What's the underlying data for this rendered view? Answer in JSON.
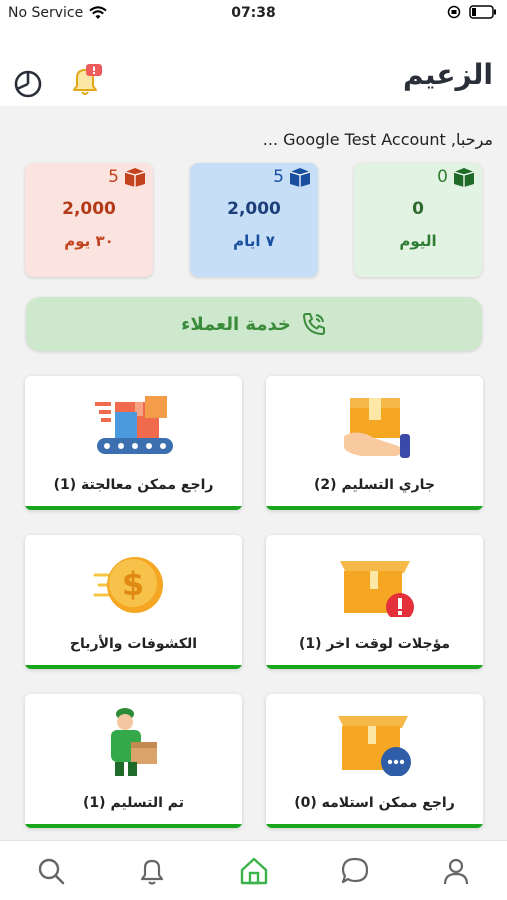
{
  "status_bar": {
    "carrier": "No Service",
    "time": "07:38"
  },
  "header": {
    "title": "الزعيم"
  },
  "greeting": "مرحبا, Google Test Account ...",
  "stats": [
    {
      "count": "0",
      "amount": "0",
      "period": "اليوم",
      "color": "#2e7d32",
      "bg": "#e3f3e3"
    },
    {
      "count": "5",
      "amount": "2,000",
      "period": "٧ ايام",
      "color": "#1a4fa0",
      "bg": "#c6dff7"
    },
    {
      "count": "5",
      "amount": "2,000",
      "period": "٣٠ يوم",
      "color": "#c2431d",
      "bg": "#fbe3e0"
    }
  ],
  "support": {
    "label": "خدمة العملاء"
  },
  "tiles": {
    "in_delivery": "جاري التسليم (2)",
    "returns_processing": "راجع ممكن معالجتة (1)",
    "postponed": "مؤجلات لوقت اخر (1)",
    "statements": "الكشوفات والأرباح",
    "returns_receivable": "راجع ممكن استلامه (0)",
    "delivered": "تم التسليم (1)"
  },
  "colors": {
    "accent_green": "#19a51e",
    "support_bg": "#cde8cd"
  },
  "nav": [
    "search-icon",
    "bell-icon",
    "home-icon",
    "chat-icon",
    "user-icon"
  ]
}
